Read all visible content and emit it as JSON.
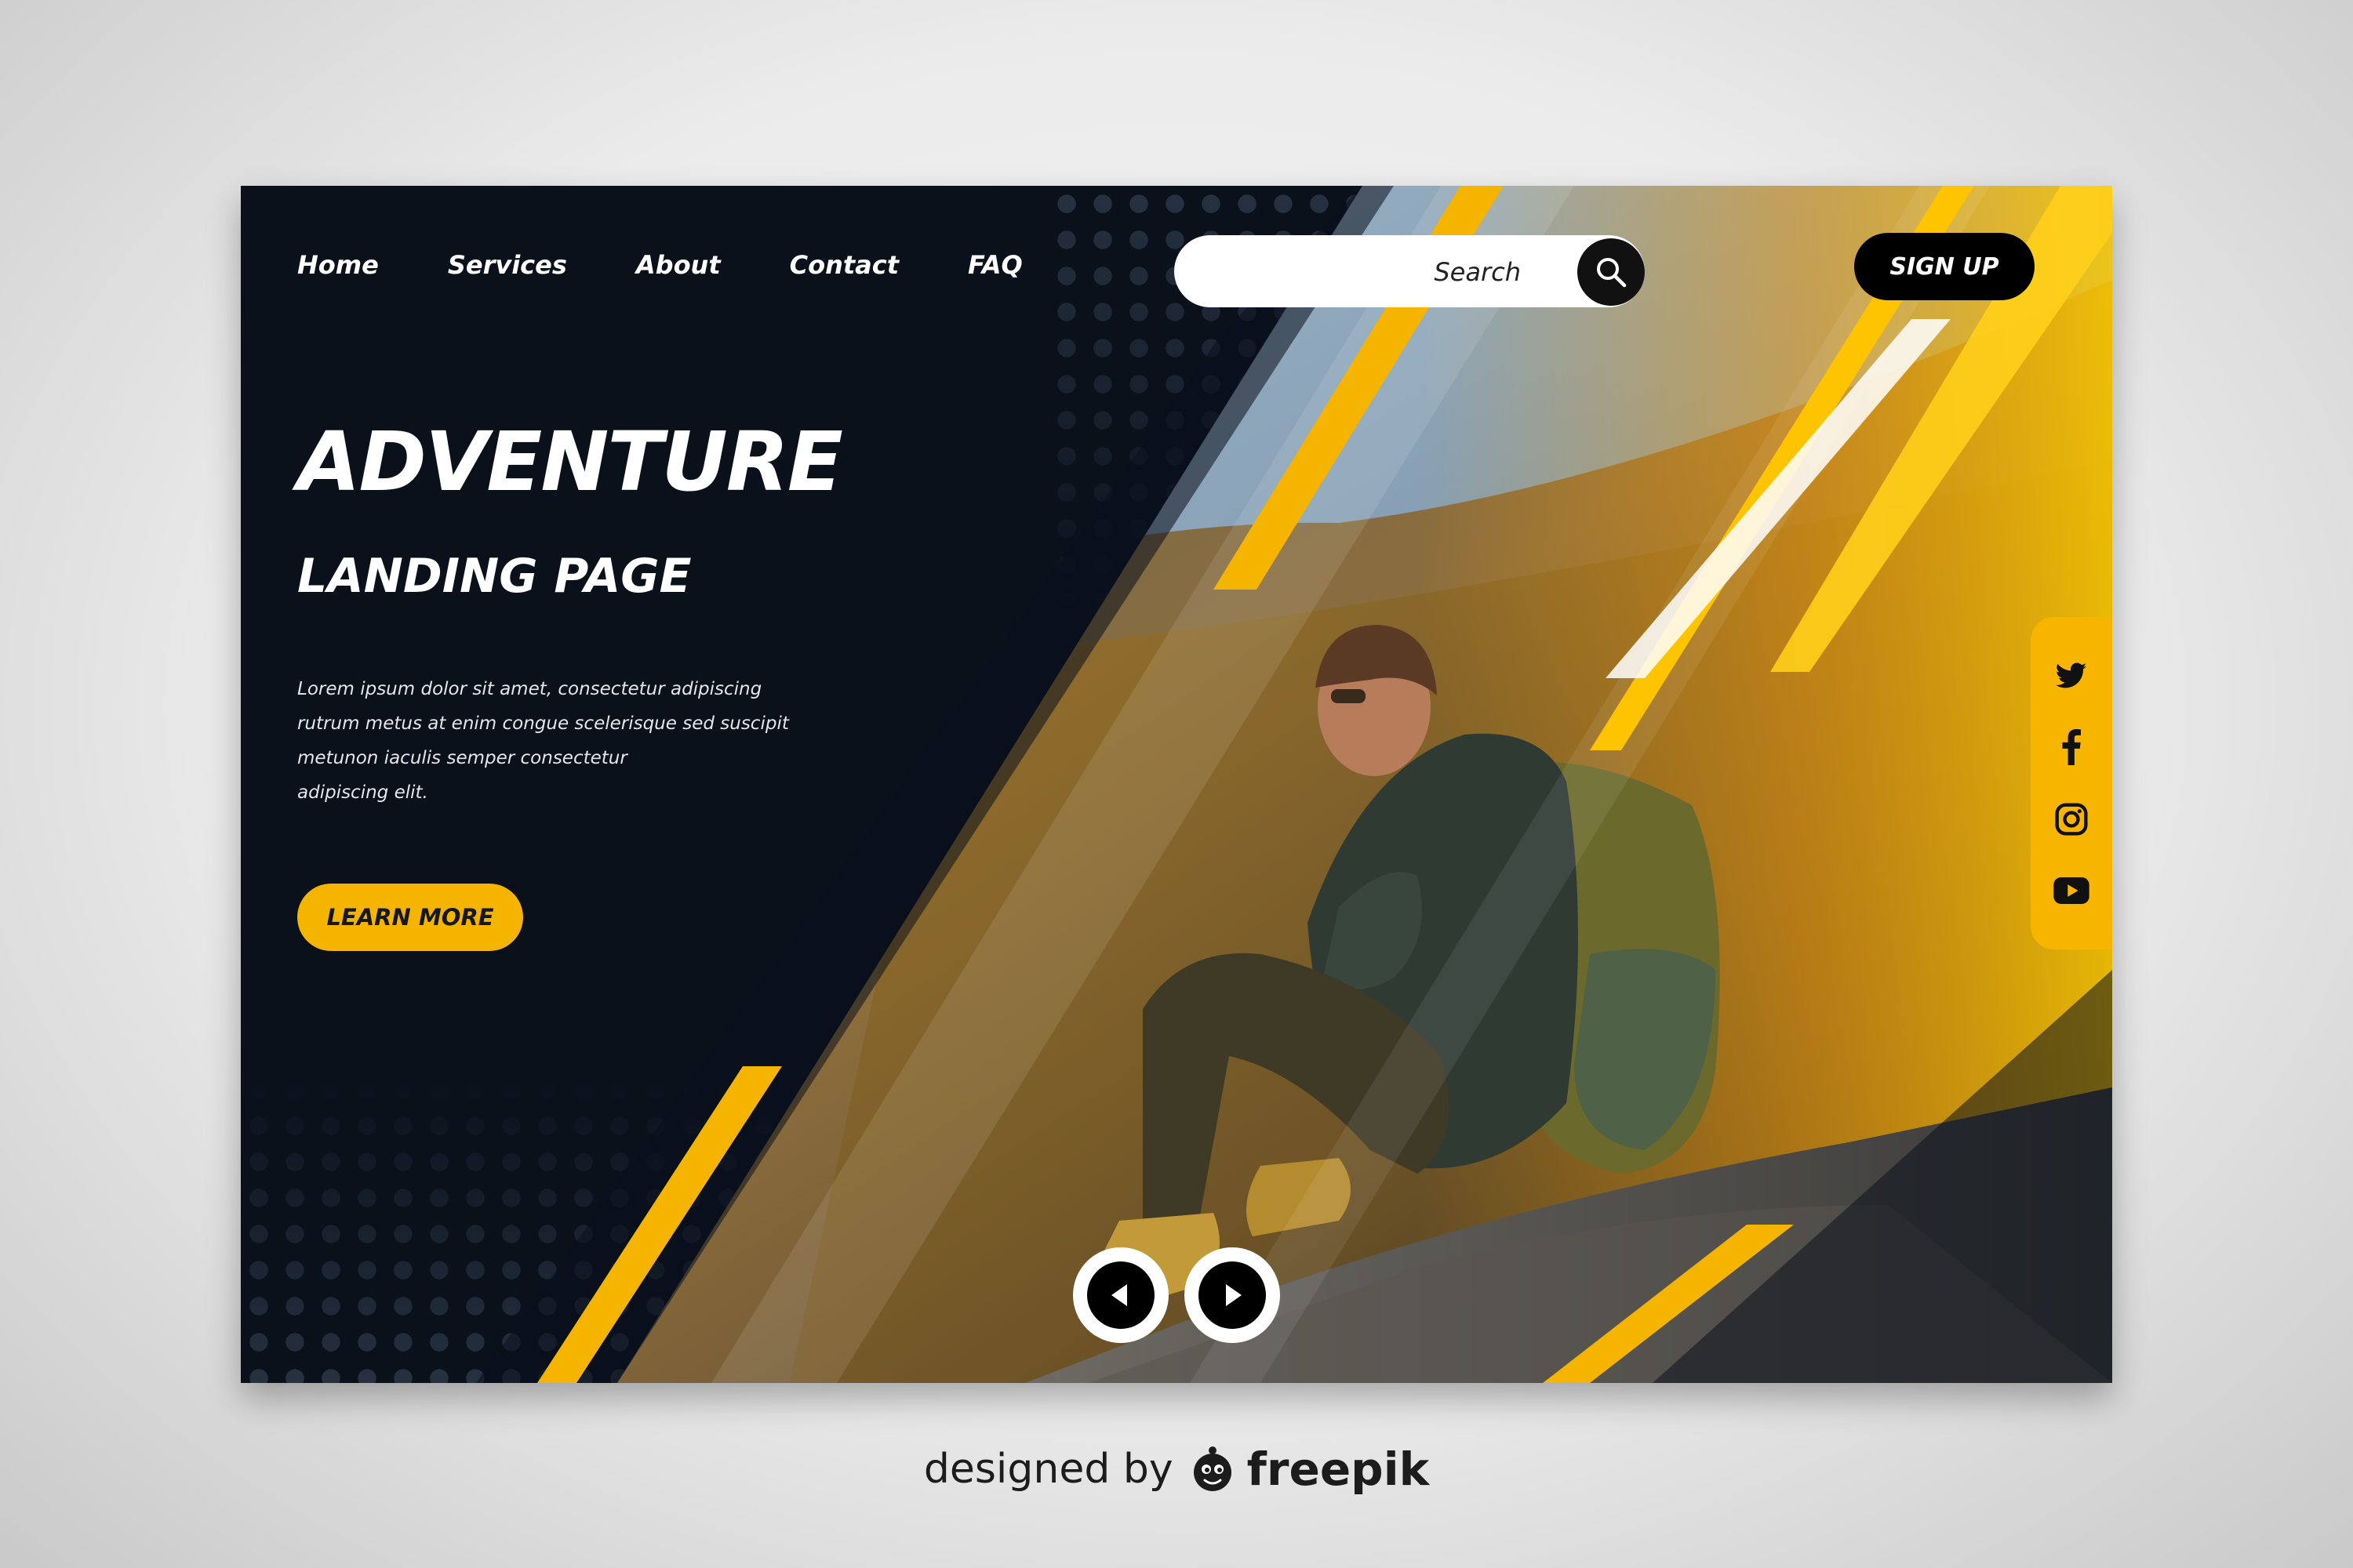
{
  "nav": {
    "links": [
      "Home",
      "Services",
      "About",
      "Contact",
      "FAQ"
    ]
  },
  "search": {
    "placeholder": "Search"
  },
  "header": {
    "signup_label": "SIGN UP"
  },
  "hero": {
    "title": "ADVENTURE",
    "subtitle": "LANDING PAGE",
    "body": "Lorem ipsum dolor sit amet, consectetur adipiscing\nrutrum metus at enim congue scelerisque sed suscipit\nmetunon iaculis semper consectetur\nadipiscing elit.",
    "cta_label": "LEARN MORE",
    "image": "man-with-backpack-sitting-on-mountain-photo"
  },
  "social": {
    "icons": [
      "twitter-icon",
      "facebook-icon",
      "instagram-icon",
      "youtube-icon"
    ]
  },
  "slider": {
    "prev_icon": "chevron-left-icon",
    "next_icon": "chevron-right-icon"
  },
  "credit": {
    "prefix": "designed by",
    "brand": "freepik",
    "logo_icon": "freepik-logo-icon"
  },
  "colors": {
    "accent": "#f5b400",
    "background": "#0b111b",
    "page": "#e6e6e6"
  }
}
